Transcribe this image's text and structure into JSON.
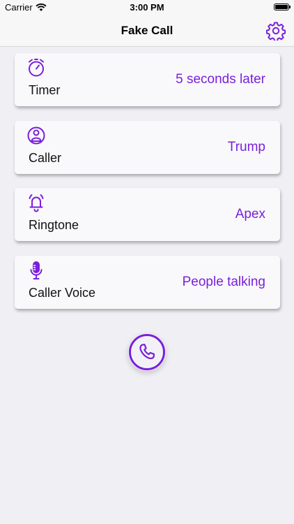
{
  "status_bar": {
    "carrier": "Carrier",
    "time": "3:00 PM",
    "icons": [
      "wifi-icon",
      "battery-icon"
    ]
  },
  "nav": {
    "title": "Fake Call",
    "settings_icon": "gear-icon"
  },
  "settings": [
    {
      "key": "timer",
      "icon": "stopwatch-icon",
      "label": "Timer",
      "value": "5 seconds later"
    },
    {
      "key": "caller",
      "icon": "person-icon",
      "label": "Caller",
      "value": "Trump"
    },
    {
      "key": "ringtone",
      "icon": "bell-ringing-icon",
      "label": "Ringtone",
      "value": "Apex"
    },
    {
      "key": "caller_voice",
      "icon": "microphone-icon",
      "label": "Caller Voice",
      "value": "People talking"
    }
  ],
  "call_button": {
    "icon": "phone-icon"
  },
  "colors": {
    "accent": "#7a1fdc",
    "background": "#efeff4",
    "card": "#f9f9fb"
  }
}
